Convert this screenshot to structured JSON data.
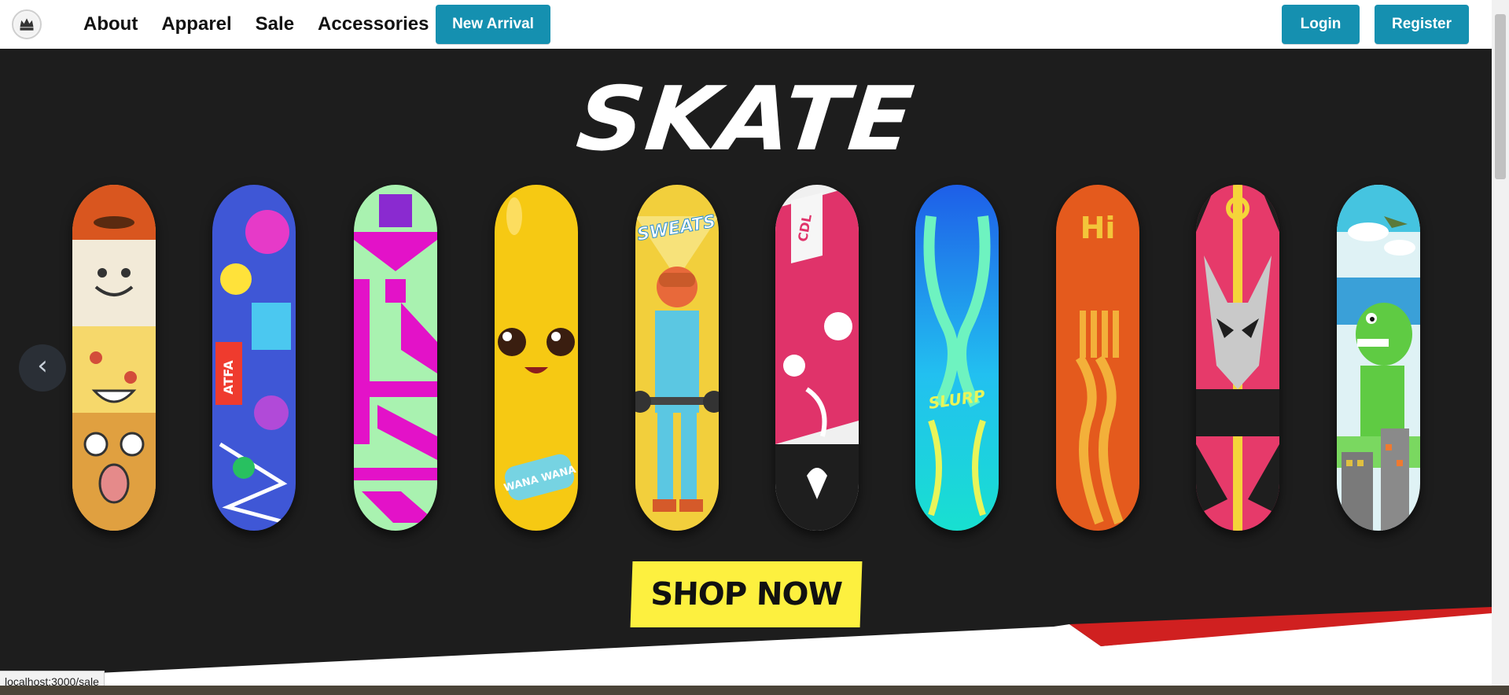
{
  "nav": {
    "links": [
      "About",
      "Apparel",
      "Sale",
      "Accessories"
    ],
    "new_arrival": "New Arrival",
    "login": "Login",
    "register": "Register"
  },
  "hero": {
    "title": "SKATE",
    "prev_arrow": "‹",
    "cta": "SHOP NOW",
    "decks": [
      {
        "name": "food-faces",
        "text": ""
      },
      {
        "name": "sticker-bomb",
        "text": "ATFA"
      },
      {
        "name": "green-magenta",
        "text": ""
      },
      {
        "name": "peely-yellow",
        "text": "WANA WANA"
      },
      {
        "name": "sweats",
        "text": "SWEATS"
      },
      {
        "name": "graffiti-pink",
        "text": "CDL"
      },
      {
        "name": "slurp-blue",
        "text": "SLURP"
      },
      {
        "name": "hi-orange",
        "text": "Hi"
      },
      {
        "name": "pink-fox",
        "text": ""
      },
      {
        "name": "dino-city",
        "text": ""
      }
    ]
  },
  "status": {
    "url": "localhost:3000/sale"
  },
  "colors": {
    "accent": "#1590b0",
    "hero_bg": "#1d1d1d",
    "cta_bg": "#fdf03f"
  }
}
